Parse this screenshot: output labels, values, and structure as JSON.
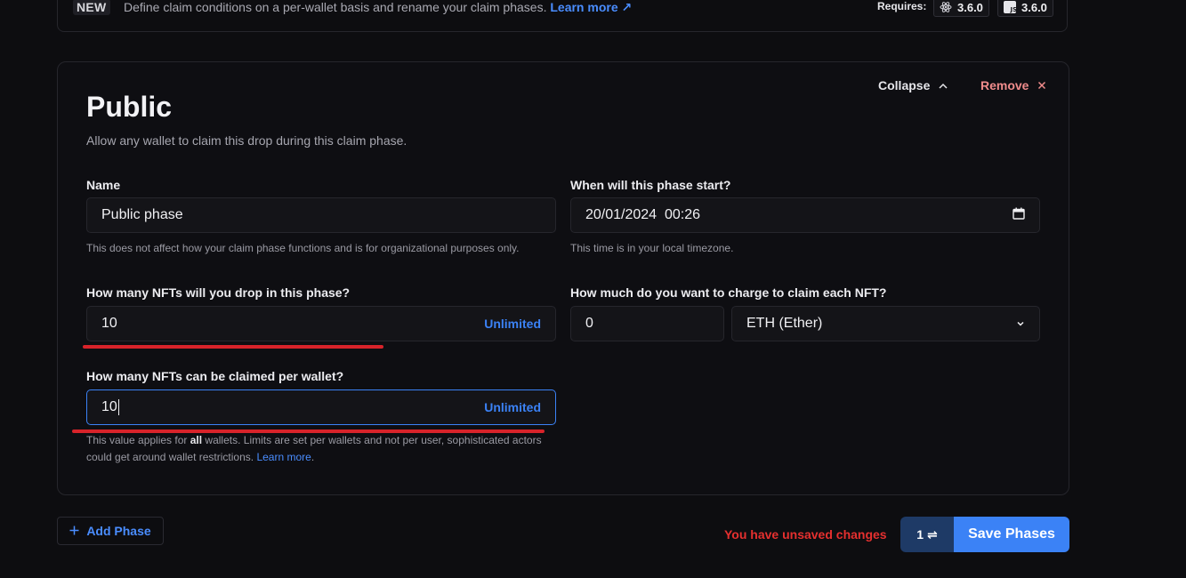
{
  "banner": {
    "badge": "NEW",
    "text": "Define claim conditions on a per-wallet basis and rename your claim phases.",
    "link": "Learn more ↗",
    "requires_label": "Requires:",
    "react_version": "3.6.0",
    "js_version": "3.6.0"
  },
  "phase": {
    "title": "Public",
    "subtitle": "Allow any wallet to claim this drop during this claim phase.",
    "collapse_label": "Collapse",
    "remove_label": "Remove",
    "name_label": "Name",
    "name_value": "Public phase",
    "name_help": "This does not affect how your claim phase functions and is for organizational purposes only.",
    "start_label": "When will this phase start?",
    "start_value": "20/01/2024  00:26",
    "start_help": "This time is in your local timezone.",
    "drop_label": "How many NFTs will you drop in this phase?",
    "drop_value": "10",
    "unlimited_label": "Unlimited",
    "charge_label": "How much do you want to charge to claim each NFT?",
    "price_value": "0",
    "currency_value": "ETH (Ether)",
    "per_wallet_label": "How many NFTs can be claimed per wallet?",
    "per_wallet_value": "10",
    "per_wallet_help_1": "This value applies for",
    "per_wallet_help_bold": "all",
    "per_wallet_help_2": "wallets. Limits are set per wallets and not per user, sophisticated actors could get around wallet restrictions.",
    "per_wallet_help_link": "Learn more",
    "per_wallet_help_end": "."
  },
  "footer": {
    "add_phase": "Add Phase",
    "unsaved": "You have unsaved changes",
    "changes_count": "1",
    "save_label": "Save Phases"
  },
  "colors": {
    "accent": "#3b82f6",
    "danger": "#e5302f",
    "annotation": "#d8232a"
  }
}
